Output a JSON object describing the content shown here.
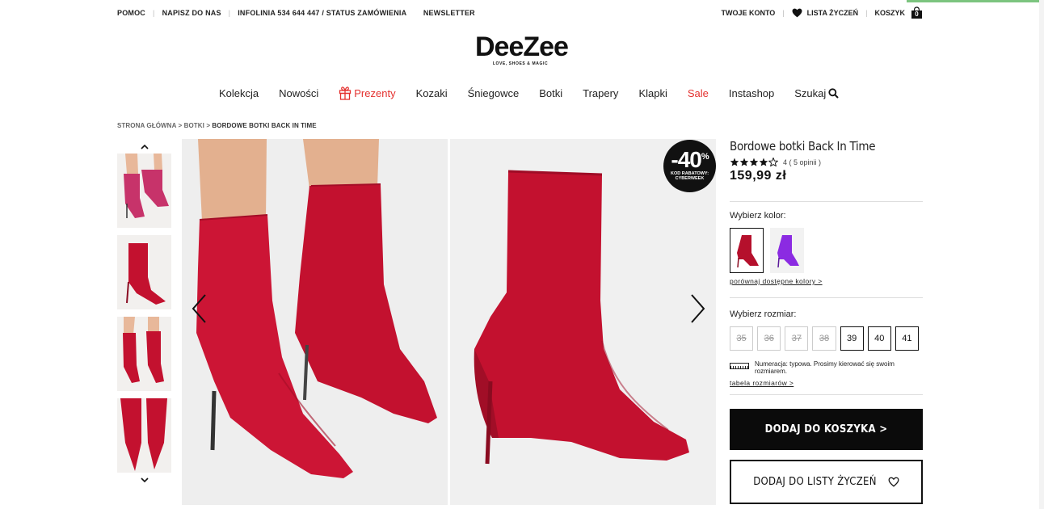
{
  "topbar": {
    "help": "POMOC",
    "write_to_us": "NAPISZ DO NAS",
    "hotline": "INFOLINIA 534 644 447 / STATUS ZAMÓWIENIA",
    "newsletter": "NEWSLETTER",
    "account": "TWOJE KONTO",
    "wishlist": "LISTA ŻYCZEŃ",
    "cart": "KOSZYK",
    "cart_count": "0"
  },
  "logo": {
    "name": "DeeZee",
    "tagline": "LOVE, SHOES & MAGIC"
  },
  "nav": {
    "items": [
      "Kolekcja",
      "Nowości",
      "Prezenty",
      "Kozaki",
      "Śniegowce",
      "Botki",
      "Trapery",
      "Klapki",
      "Sale",
      "Instashop",
      "Szukaj"
    ]
  },
  "breadcrumb": {
    "home": "STRONA GŁÓWNA",
    "category": "BOTKI",
    "current": "BORDOWE BOTKI BACK IN TIME",
    "separator": ">"
  },
  "badge": {
    "discount": "-40",
    "percent": "%",
    "line1": "KOD RABATOWY:",
    "line2": "CYBERWEEK"
  },
  "product": {
    "title": "Bordowe botki Back In Time",
    "rating_value": 4,
    "rating_text": "4 ( 5 opinii )",
    "price": "159,99 zł",
    "color_label": "Wybierz kolor:",
    "compare_colors": "porównaj dostępne kolory >",
    "size_label": "Wybierz rozmiar:",
    "sizes": [
      {
        "label": "35",
        "available": false
      },
      {
        "label": "36",
        "available": false
      },
      {
        "label": "37",
        "available": false
      },
      {
        "label": "38",
        "available": false
      },
      {
        "label": "39",
        "available": true
      },
      {
        "label": "40",
        "available": true
      },
      {
        "label": "41",
        "available": true
      }
    ],
    "size_note": "Numeracja: typowa. Prosimy kierować się swoim rozmiarem.",
    "size_table": "tabela rozmiarów >",
    "add_to_cart": "DODAJ DO KOSZYKA >",
    "add_to_wishlist": "DODAJ DO LISTY ŻYCZEŃ",
    "colors": [
      "#b5102c",
      "#8b2be2"
    ]
  },
  "colors": {
    "accent_red": "#e4312f",
    "boot_red": "#c3112f",
    "black": "#0b0b0b"
  }
}
